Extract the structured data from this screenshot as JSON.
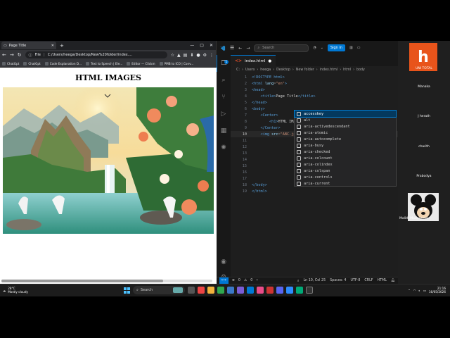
{
  "browser": {
    "tab_title": "Page Title",
    "new_tab": "+",
    "url_prefix": "File",
    "url": "C:/Users/heega/Desktop/New%20folder/index....",
    "bookmarks": [
      "ChatGpt",
      "ChatGpt",
      "Code Explanation D...",
      "Text to Speech | Ele...",
      "Editor — Clickm",
      "PMB to ICO | Conv..."
    ],
    "page": {
      "heading": "HTML IMAGES"
    }
  },
  "vscode": {
    "search_placeholder": "Search",
    "signin_label": "Sign in",
    "tab_label": "index.html",
    "breadcrumb": [
      "C:",
      "Users",
      "heega",
      "Desktop",
      "New folder",
      "index.html",
      "html",
      "body"
    ],
    "lines": [
      {
        "n": "1",
        "code": [
          [
            "t",
            "<!DOCTYPE html>"
          ]
        ]
      },
      {
        "n": "2",
        "code": [
          [
            "t",
            "<html "
          ],
          [
            "a",
            "lang"
          ],
          [
            "p",
            "="
          ],
          [
            "s",
            "\"en\""
          ],
          [
            "t",
            ">"
          ]
        ]
      },
      {
        "n": "3",
        "code": [
          [
            "t",
            "<head>"
          ]
        ]
      },
      {
        "n": "4",
        "code": [
          [
            "txt",
            "    "
          ],
          [
            "t",
            "<title>"
          ],
          [
            "txt",
            "Page Title"
          ],
          [
            "t",
            "</title>"
          ]
        ]
      },
      {
        "n": "5",
        "code": [
          [
            "t",
            "</head>"
          ]
        ]
      },
      {
        "n": "6",
        "code": [
          [
            "t",
            "<body>"
          ]
        ]
      },
      {
        "n": "7",
        "code": [
          [
            "txt",
            "    "
          ],
          [
            "t",
            "<Center>"
          ]
        ]
      },
      {
        "n": "8",
        "code": [
          [
            "txt",
            "        "
          ],
          [
            "t",
            "<h1>"
          ],
          [
            "txt",
            "HTML IMAGES"
          ],
          [
            "t",
            "</h1>"
          ]
        ]
      },
      {
        "n": "9",
        "code": [
          [
            "txt",
            "    "
          ],
          [
            "t",
            "</Center>"
          ]
        ]
      },
      {
        "n": "10",
        "code": [
          [
            "txt",
            "    "
          ],
          [
            "t",
            "<img "
          ],
          [
            "a",
            "src"
          ],
          [
            "p",
            "="
          ],
          [
            "s",
            "\"ABC.jpg\""
          ],
          [
            "txt",
            " a"
          ]
        ]
      },
      {
        "n": "11",
        "code": []
      },
      {
        "n": "12",
        "code": []
      },
      {
        "n": "13",
        "code": []
      },
      {
        "n": "14",
        "code": []
      },
      {
        "n": "15",
        "code": []
      },
      {
        "n": "16",
        "code": []
      },
      {
        "n": "17",
        "code": []
      },
      {
        "n": "18",
        "code": [
          [
            "t",
            "</body>"
          ]
        ]
      },
      {
        "n": "19",
        "code": [
          [
            "t",
            "</html>"
          ]
        ]
      }
    ],
    "suggestions": [
      "accesskey",
      "alt",
      "aria-activedescendant",
      "aria-atomic",
      "aria-autocomplete",
      "aria-busy",
      "aria-checked",
      "aria-colcount",
      "aria-colindex",
      "aria-colspan",
      "aria-controls",
      "aria-current"
    ],
    "status": {
      "errors": "0",
      "warnings": "0",
      "position": "Ln 10, Col 25",
      "spaces": "Spaces: 4",
      "encoding": "UTF-8",
      "eol": "CRLF",
      "language": "HTML"
    }
  },
  "meeting": {
    "logo_letter": "h",
    "top_label": "UNI TOTAL",
    "participants": [
      "Manaka",
      "J herath",
      "charith",
      "Prabodya"
    ],
    "tile_label": "Malith Madusanka"
  },
  "taskbar": {
    "temp": "28°C",
    "weather": "Mostly cloudy",
    "search_placeholder": "Search",
    "time": "21:16",
    "date": "16/05/2026"
  },
  "colors": {
    "vscode_accent": "#0078d4",
    "meeting_logo": "#e8541b"
  }
}
